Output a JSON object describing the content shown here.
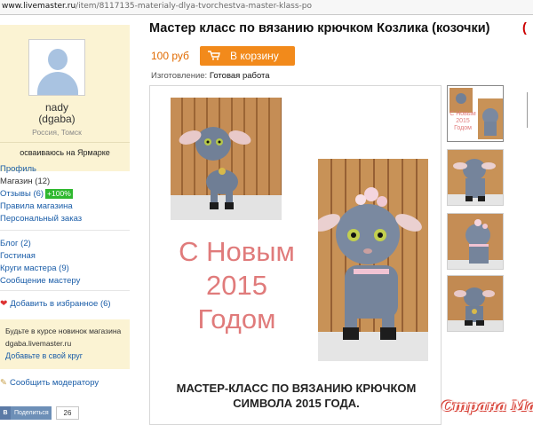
{
  "browser": {
    "url_host": "www.livemaster.ru",
    "url_path": "/item/8117135-materialy-dlya-tvorchestva-master-klass-po"
  },
  "seller": {
    "name": "nady",
    "nick": "(dgaba)",
    "location": "Россия, Томск",
    "status": "осваиваюсь на Ярмарке"
  },
  "menu": {
    "profile": "Профиль",
    "shop": "Магазин (12)",
    "reviews": "Отзывы (6)",
    "reviews_badge": "+100%",
    "shop_rules": "Правила магазина",
    "personal_order": "Персональный заказ",
    "blog": "Блог (2)",
    "guestbook": "Гостиная",
    "master_circles": "Круги мастера (9)",
    "message_master": "Сообщение мастеру"
  },
  "favorites": {
    "label": "Добавить в избранное",
    "count": "(6)"
  },
  "news_box": {
    "line1": "Будьте в курсе новинок магазина",
    "line2": "dgaba.livemaster.ru",
    "link": "Добавьте в свой круг"
  },
  "report_link": "Сообщить модератору",
  "share": {
    "vk_letter": "B",
    "button_label": "Поделиться",
    "count": "26"
  },
  "product": {
    "title": "Мастер класс по вязанию крючком Козлика (козочки)",
    "title_extra": "(",
    "price": "100 руб",
    "cart_button": "В корзину",
    "made_label": "Изготовление:",
    "made_value": "Готовая работа"
  },
  "photo": {
    "greeting_line1": "С Новым",
    "greeting_line2": "2015",
    "greeting_line3": "Годом",
    "caption_line1": "МАСТЕР-КЛАСС ПО ВЯЗАНИЮ КРЮЧКОМ",
    "caption_line2": "СИМВОЛА 2015 ГОДА."
  },
  "thumbnail_text": {
    "line1": "С Новым",
    "line2": "2015",
    "line3": "Годом"
  },
  "watermark": "Страна Мам",
  "colors": {
    "accent_orange": "#f28a1b",
    "price_orange": "#e06a00",
    "sidebar_bg": "#fbf3d3",
    "link_blue": "#1a5da8",
    "badge_green": "#2fb82f",
    "greeting_pink": "#e07b7b"
  }
}
